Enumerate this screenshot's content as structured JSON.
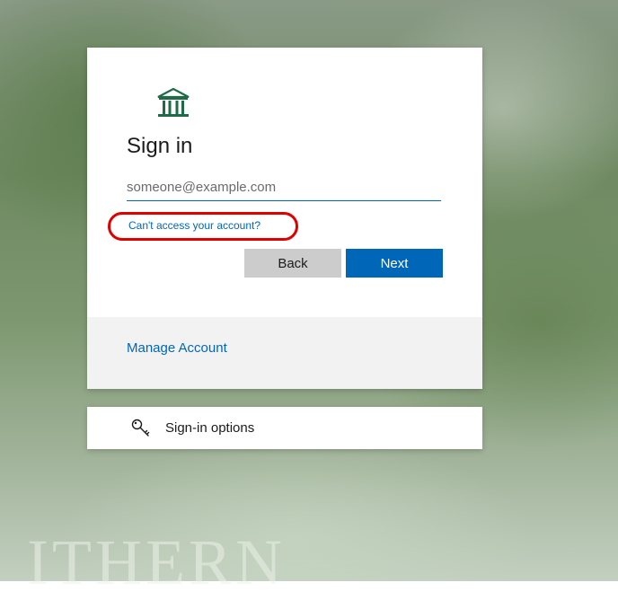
{
  "background": {
    "watermark_text": "ITHERN"
  },
  "card": {
    "logo_icon": "institution-columns-icon",
    "title": "Sign in",
    "email_placeholder": "someone@example.com",
    "email_value": "",
    "cant_access_link": "Can't access your account?",
    "back_button": "Back",
    "next_button": "Next",
    "footer": {
      "manage_account_link": "Manage Account"
    }
  },
  "signin_options": {
    "icon": "key-icon",
    "label": "Sign-in options"
  },
  "colors": {
    "accent": "#0067b8",
    "secondary_button": "#cccccc",
    "footer_bg": "#f2f2f2",
    "annotation": "#e00000",
    "logo": "#1e6b45"
  }
}
